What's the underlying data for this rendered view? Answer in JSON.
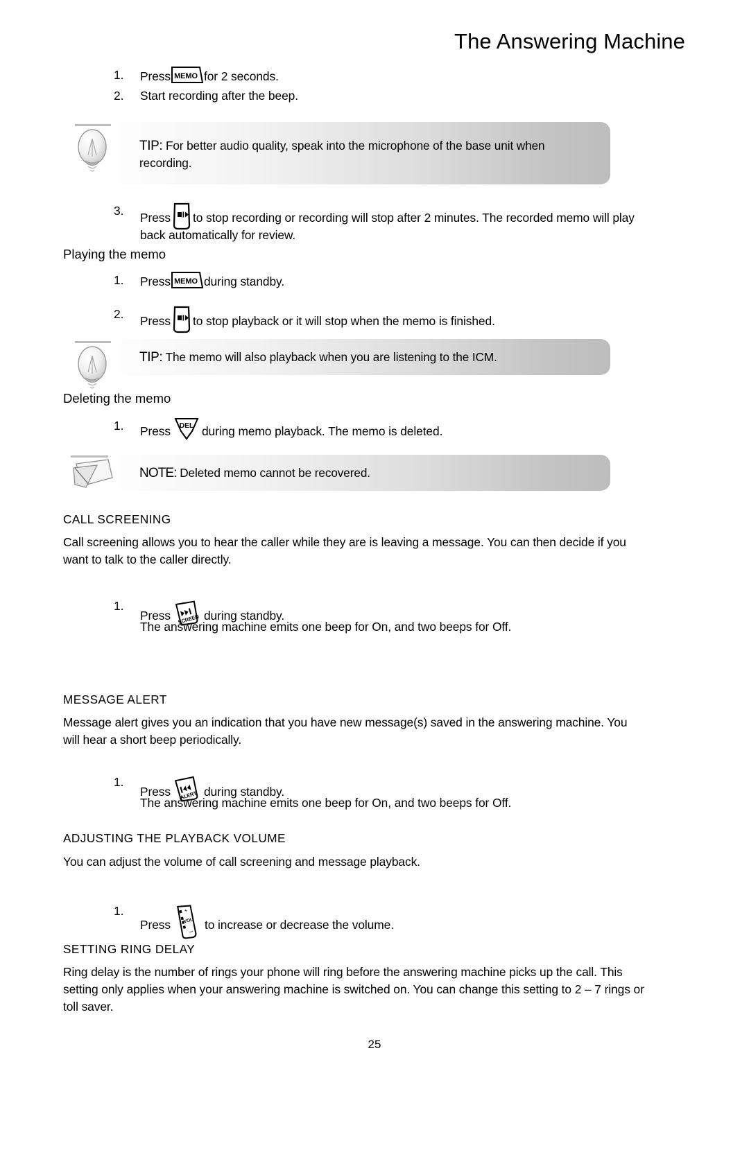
{
  "header": {
    "title": "The Answering Machine"
  },
  "recording_steps": [
    {
      "num": "1.",
      "before": "Press",
      "icon": "memo-key-icon",
      "after": "for 2 seconds."
    },
    {
      "num": "2.",
      "before": "Start recording after the beep.",
      "icon": "",
      "after": ""
    }
  ],
  "tip_recording": {
    "icon": "lightbulb-icon",
    "lead": "TIP:",
    "text": "For better audio quality, speak into the microphone of the base unit when recording."
  },
  "recording_step3": {
    "num": "3.",
    "before": "Press",
    "icon": "stop-play-key-icon",
    "after": "to stop recording or recording will stop after 2 minutes. The recorded memo will play back automatically for review."
  },
  "playing_memo": {
    "heading": "Playing the memo",
    "steps": [
      {
        "num": "1.",
        "before": "Press",
        "icon": "memo-key-icon",
        "after": "during standby."
      },
      {
        "num": "2.",
        "before": "Press",
        "icon": "stop-play-key-icon",
        "after": "to stop playback or it will stop when the memo is finished."
      }
    ]
  },
  "tip_icm": {
    "icon": "lightbulb-icon",
    "lead": "TIP:",
    "text": "The memo will also playback when you are listening to the ICM."
  },
  "deleting_memo": {
    "heading": "Deleting the memo",
    "steps": [
      {
        "num": "1.",
        "before": "Press",
        "icon": "del-key-icon",
        "after": "during memo playback. The memo is deleted."
      }
    ]
  },
  "note_deleted": {
    "icon": "note-paper-icon",
    "lead": "NOTE:",
    "text": "Deleted memo cannot be recovered."
  },
  "call_screening": {
    "heading": "CALL SCREENING",
    "body": "Call screening allows you to hear the caller while they are is leaving a message. You can then decide if you want to talk to the caller directly.",
    "steps": [
      {
        "num": "1.",
        "before": "Press",
        "icon": "screen-key-icon",
        "after": "during standby."
      }
    ],
    "note": "The answering machine emits one beep for On, and two beeps for Off."
  },
  "message_alert": {
    "heading": "MESSAGE ALERT",
    "body": "Message alert gives you an indication that you have new message(s) saved in the answering machine. You will hear a short beep periodically.",
    "steps": [
      {
        "num": "1.",
        "before": "Press",
        "icon": "alert-key-icon",
        "after": "during standby."
      }
    ],
    "note": "The answering machine emits one beep for On, and two beeps for Off."
  },
  "playback_volume": {
    "heading": "ADJUSTING THE PLAYBACK VOLUME",
    "body": "You can adjust the volume of call screening and message playback.",
    "steps": [
      {
        "num": "1.",
        "before": "Press",
        "icon": "vol-key-icon",
        "after": "to increase or decrease the volume."
      }
    ]
  },
  "ring_delay": {
    "heading": "SETTING RING DELAY",
    "body": "Ring delay is the number of rings your phone will ring before the answering machine picks up the call. This setting only applies when your answering machine is switched on. You can change this setting to 2 – 7 rings or toll saver."
  },
  "key_labels": {
    "memo": "MEMO",
    "del": "DEL",
    "screen": "SCREEN",
    "alert": "ALERT",
    "vol": "VOL",
    "vol_plus": "+",
    "vol_minus": "–"
  },
  "footer": {
    "page_number": "25"
  },
  "colors": {
    "text": "#000000",
    "callout_gradient_start": "#fdfdfd",
    "callout_gradient_end": "#bdbdbd",
    "page_background": "#ffffff"
  }
}
